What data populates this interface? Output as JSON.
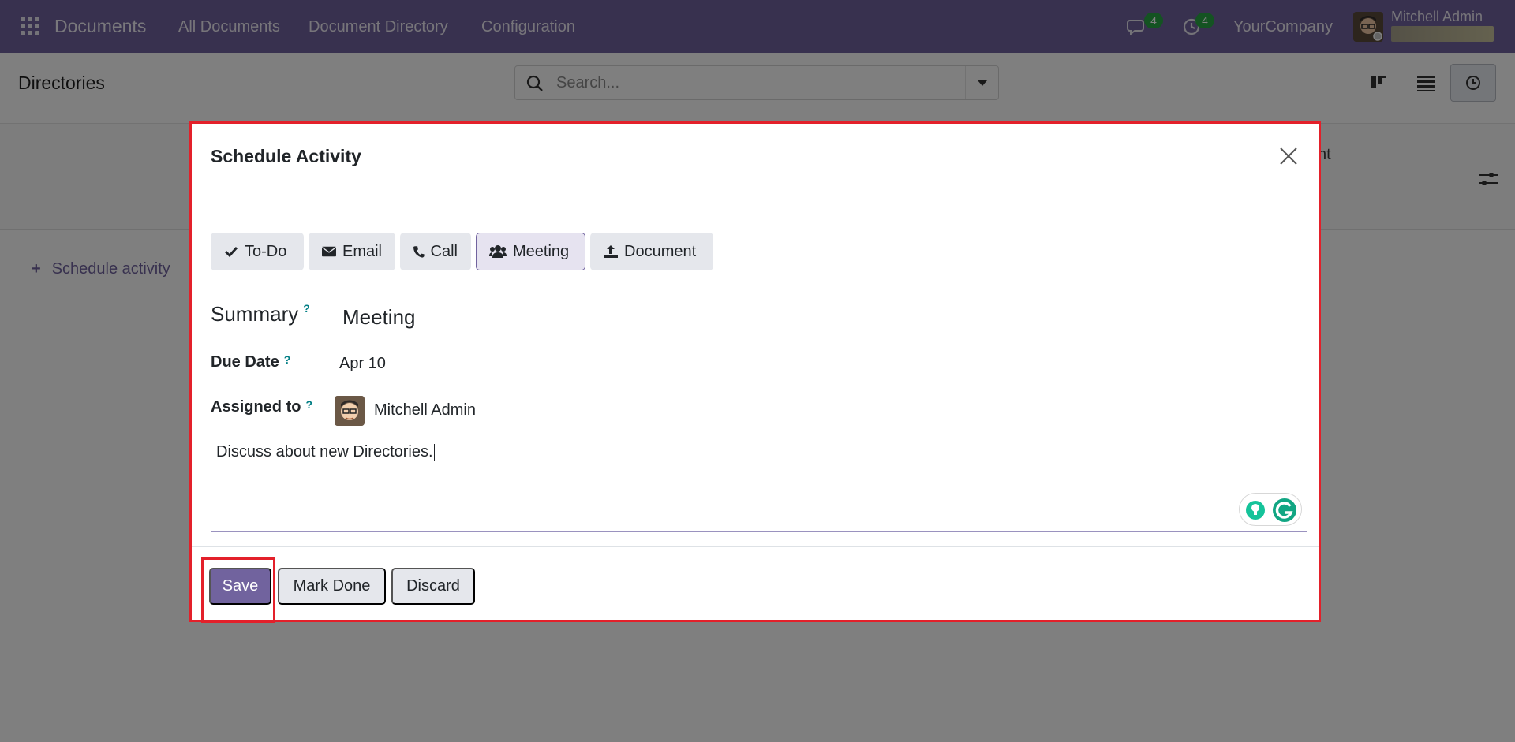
{
  "navbar": {
    "app_name": "Documents",
    "menu": [
      "All Documents",
      "Document Directory",
      "Configuration"
    ],
    "messages_count": "4",
    "activities_count": "4",
    "company": "YourCompany",
    "user_name": "Mitchell Admin"
  },
  "control_panel": {
    "title": "Directories",
    "search_placeholder": "Search..."
  },
  "background": {
    "partial_text": "nt",
    "schedule_link": "Schedule activity"
  },
  "dialog": {
    "title": "Schedule Activity",
    "activity_types": [
      "To-Do",
      "Email",
      "Call",
      "Meeting",
      "Document"
    ],
    "selected_type": "Meeting",
    "summary_label": "Summary",
    "summary_value": "Meeting",
    "due_date_label": "Due Date",
    "due_date_value": "Apr 10",
    "assigned_label": "Assigned to",
    "assigned_value": "Mitchell Admin",
    "help_mark": "?",
    "note": "Discuss about new Directories.",
    "buttons": {
      "save": "Save",
      "mark_done": "Mark Done",
      "discard": "Discard"
    }
  },
  "colors": {
    "brand": "#71639e",
    "highlight": "#e3202a",
    "badge": "#28a745",
    "help": "#017e84"
  }
}
